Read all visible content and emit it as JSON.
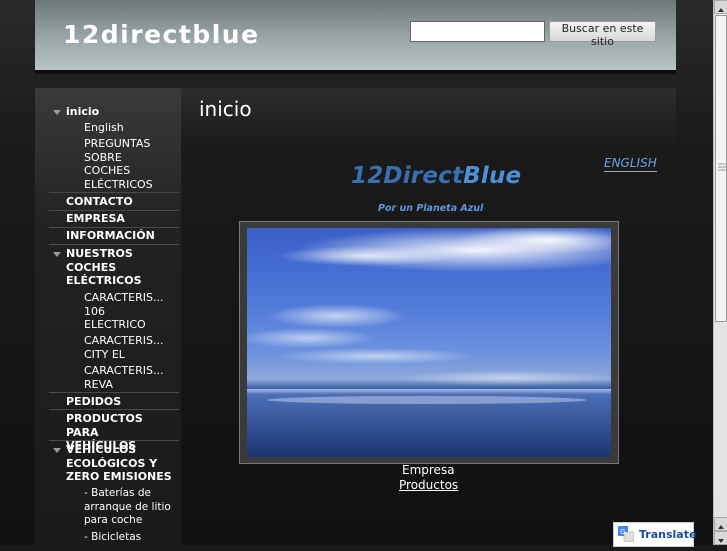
{
  "header": {
    "site_title": "12directblue",
    "search_placeholder": "",
    "search_button": "Buscar en este sitio"
  },
  "sidebar": {
    "items": [
      {
        "label": "inicio"
      },
      {
        "label": "English"
      },
      {
        "label": "PREGUNTAS SOBRE COCHES ELÉCTRICOS"
      },
      {
        "label": "CONTACTO"
      },
      {
        "label": "EMPRESA"
      },
      {
        "label": "INFORMACIÓN"
      },
      {
        "label": "NUESTROS COCHES ELÉCTRICOS"
      },
      {
        "label": "CARACTERIS... 106 ELECTRICO"
      },
      {
        "label": "CARACTERIS... CITY EL"
      },
      {
        "label": "CARACTERIS... REVA"
      },
      {
        "label": "PEDIDOS"
      },
      {
        "label": "PRODUCTOS PARA VEHÍCULOS"
      },
      {
        "label": "VEHÍCULOS ECOLÓGICOS Y ZERO EMISIONES"
      },
      {
        "label": "- Baterías de arranque de litio para coche"
      },
      {
        "label": "- Bicicletas"
      }
    ]
  },
  "main": {
    "page_title": "inicio",
    "english_link": "ENGLISH",
    "brand_part1": "12Direct",
    "brand_part2": "Blue",
    "tagline": "Por un Planeta Azul",
    "caption": "Empresa",
    "caption_link": "Productos"
  },
  "translate": {
    "label": "Translate"
  }
}
